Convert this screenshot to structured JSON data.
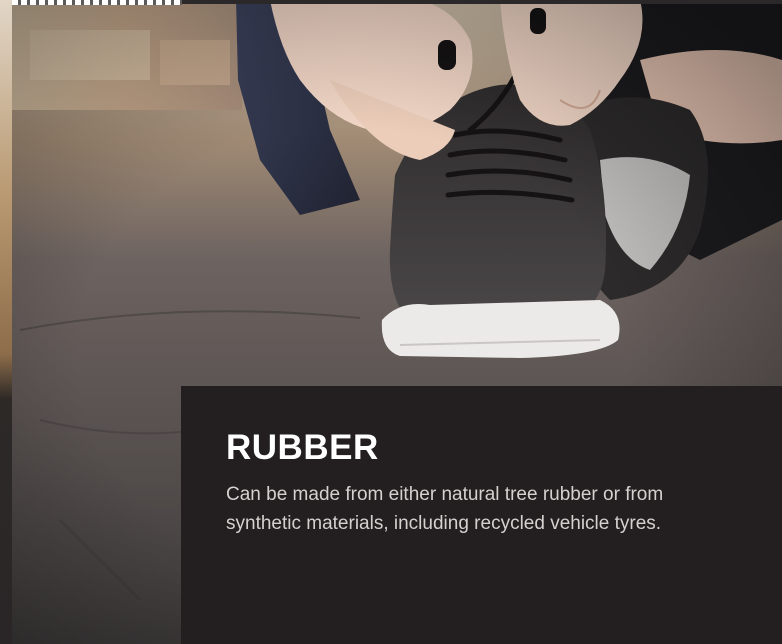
{
  "material": {
    "title": "RUBBER",
    "description": "Can be made from either natural tree rubber or from synthetic materials, including recycled vehicle tyres."
  },
  "hero": {
    "scene": "photo-sneaker-lacing",
    "colors": {
      "floor": "#4a4645",
      "shoe_upper": "#3e3b3c",
      "sole": "#ececec",
      "skin": "#f1d6c6",
      "card": "#231f20"
    }
  }
}
